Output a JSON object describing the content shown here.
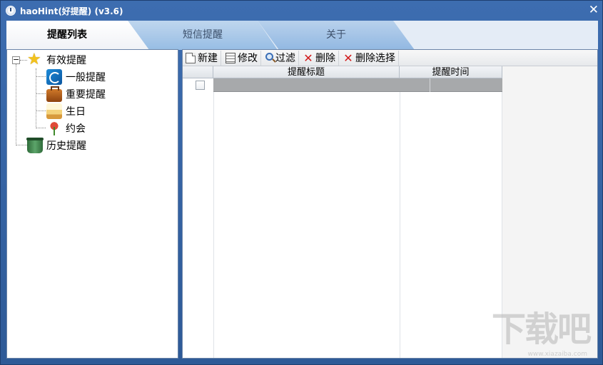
{
  "window": {
    "title": "haoHint(好提醒) (v3.6)",
    "close_glyph": "✕"
  },
  "tabs": [
    {
      "label": "提醒列表",
      "active": true
    },
    {
      "label": "短信提醒",
      "active": false
    },
    {
      "label": "关于",
      "active": false
    }
  ],
  "tree": {
    "expander": "−",
    "root": {
      "label": "有效提醒",
      "icon": "star-icon"
    },
    "children": [
      {
        "label": "一般提醒",
        "icon": "reminder-icon"
      },
      {
        "label": "重要提醒",
        "icon": "briefcase-icon"
      },
      {
        "label": "生日",
        "icon": "cake-icon"
      },
      {
        "label": "约会",
        "icon": "flower-icon"
      }
    ],
    "history": {
      "label": "历史提醒",
      "icon": "trash-icon"
    }
  },
  "toolbar": {
    "new_label": "新建",
    "edit_label": "修改",
    "filter_label": "过滤",
    "delete_label": "删除",
    "delete_selected_label": "删除选择",
    "delete_glyph": "✕"
  },
  "grid": {
    "columns": [
      "提醒标题",
      "提醒时间"
    ],
    "rows": [
      {
        "title": "",
        "time": "",
        "checked": false,
        "selected": true
      }
    ]
  },
  "watermark": {
    "text": "下载吧",
    "sub": "www.xiazaiba.com"
  },
  "colors": {
    "titlebar": "#3d6db0",
    "selected_row": "#a7a9ab",
    "accent": "#f3c21d"
  }
}
